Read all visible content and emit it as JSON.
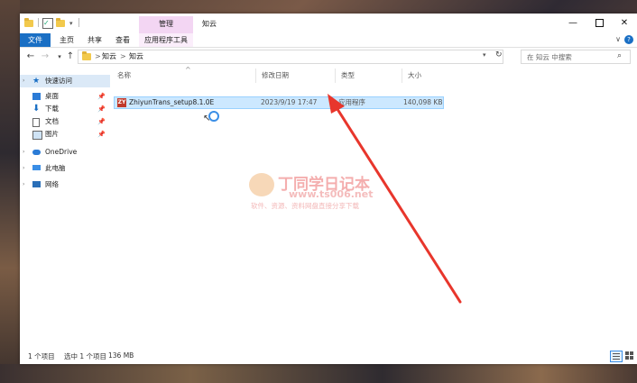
{
  "titlebar": {
    "context_tab": "管理",
    "title": "知云",
    "check_glyph": "✓",
    "dropdown_glyph": "▾"
  },
  "ribbon": {
    "tabs": [
      "文件",
      "主页",
      "共享",
      "查看",
      "应用程序工具"
    ],
    "active_tab": "文件"
  },
  "address": {
    "segments": [
      "知云",
      "知云"
    ],
    "separator": ">",
    "back_glyph": "←",
    "forward_glyph": "→",
    "up_glyph": "↑",
    "recent_glyph": "▾",
    "dropdown_glyph": "▾",
    "refresh_glyph": "↻"
  },
  "search": {
    "placeholder": "在 知云 中搜索",
    "icon_glyph": "⌕"
  },
  "nav_pane": {
    "quick_access": "快速访问",
    "pin_glyph": "📌",
    "quick_items": [
      "桌面",
      "下载",
      "文档",
      "图片"
    ],
    "onedrive": "OneDrive",
    "this_pc": "此电脑",
    "network": "网络",
    "chevron_glyph": "›"
  },
  "columns": {
    "name": "名称",
    "date": "修改日期",
    "type": "类型",
    "size": "大小",
    "sort_glyph": "^"
  },
  "files": [
    {
      "icon_text": "ZY",
      "name": "ZhiyunTrans_setup8.1.0E",
      "date": "2023/9/19 17:47",
      "type": "应用程序",
      "size": "140,098 KB"
    }
  ],
  "status": {
    "item_count": "1 个项目",
    "selected": "选中 1 个项目",
    "selected_size": "136 MB"
  },
  "watermark": {
    "title": "丁同学日记本",
    "url": "www.ts006.net",
    "subtitle": "软件、资源、资料网盘直接分享下载"
  },
  "colors": {
    "file_tab": "#1a6fc4",
    "context_tab": "#f3d6f3",
    "selection": "#cce8ff",
    "arrow": "#e8362c"
  }
}
